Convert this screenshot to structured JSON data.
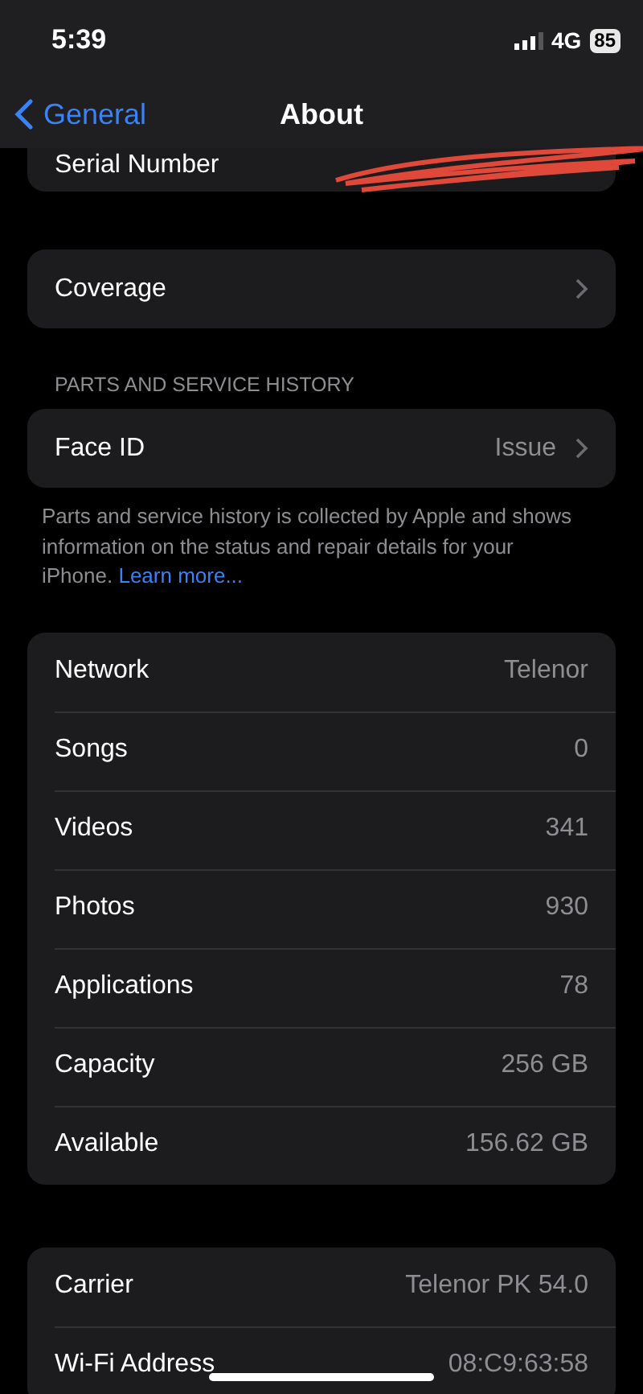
{
  "status_bar": {
    "time": "5:39",
    "network": "4G",
    "battery": "85"
  },
  "nav": {
    "back": "General",
    "title": "About"
  },
  "serial": {
    "label": "Serial Number"
  },
  "coverage": {
    "label": "Coverage"
  },
  "parts": {
    "header": "PARTS AND SERVICE HISTORY",
    "label": "Face ID",
    "value": "Issue",
    "note": "Parts and service history is collected by Apple and shows information on the status and repair details for your iPhone.",
    "link": "Learn more..."
  },
  "info": [
    {
      "label": "Network",
      "value": "Telenor"
    },
    {
      "label": "Songs",
      "value": "0"
    },
    {
      "label": "Videos",
      "value": "341"
    },
    {
      "label": "Photos",
      "value": "930"
    },
    {
      "label": "Applications",
      "value": "78"
    },
    {
      "label": "Capacity",
      "value": "256 GB"
    },
    {
      "label": "Available",
      "value": "156.62 GB"
    }
  ],
  "carrier": [
    {
      "label": "Carrier",
      "value": "Telenor PK 54.0"
    },
    {
      "label": "Wi-Fi Address",
      "value": "08:C9:63:58"
    }
  ]
}
